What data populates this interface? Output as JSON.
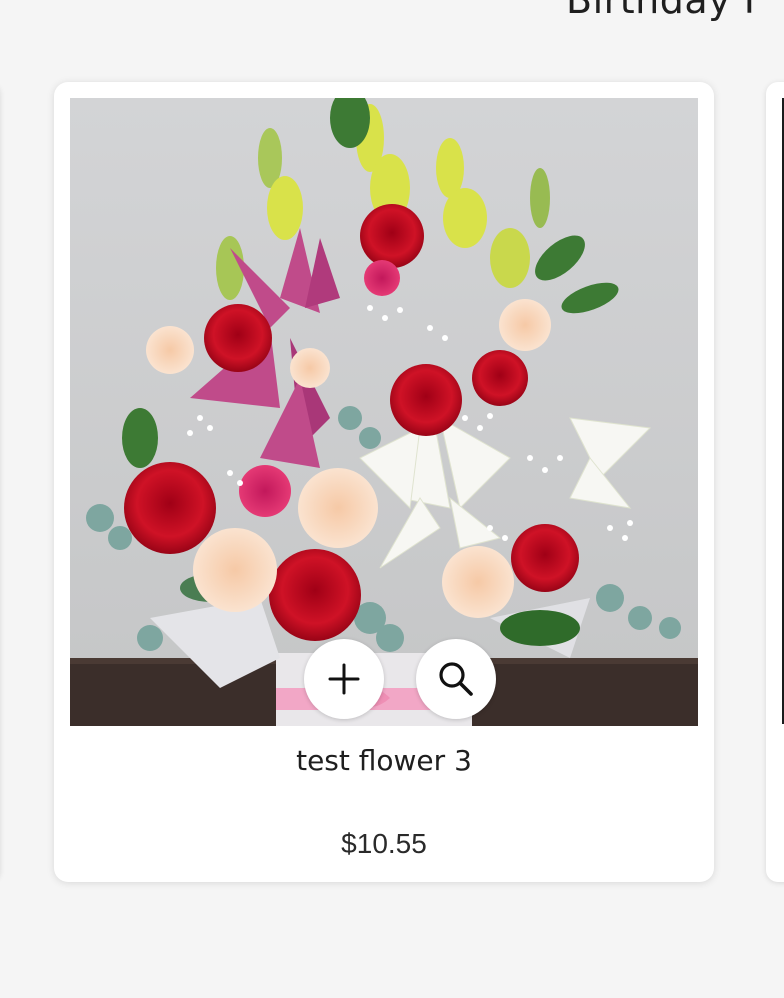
{
  "section": {
    "heading": "Birthday F"
  },
  "product": {
    "title": "test flower 3",
    "price": "$10.55",
    "image_icon": "flower-bouquet-photo"
  },
  "actions": {
    "add_icon": "plus-icon",
    "zoom_icon": "search-icon"
  },
  "colors": {
    "card_background": "#ffffff",
    "page_background": "#f5f5f5",
    "text": "#1f1f1f"
  }
}
